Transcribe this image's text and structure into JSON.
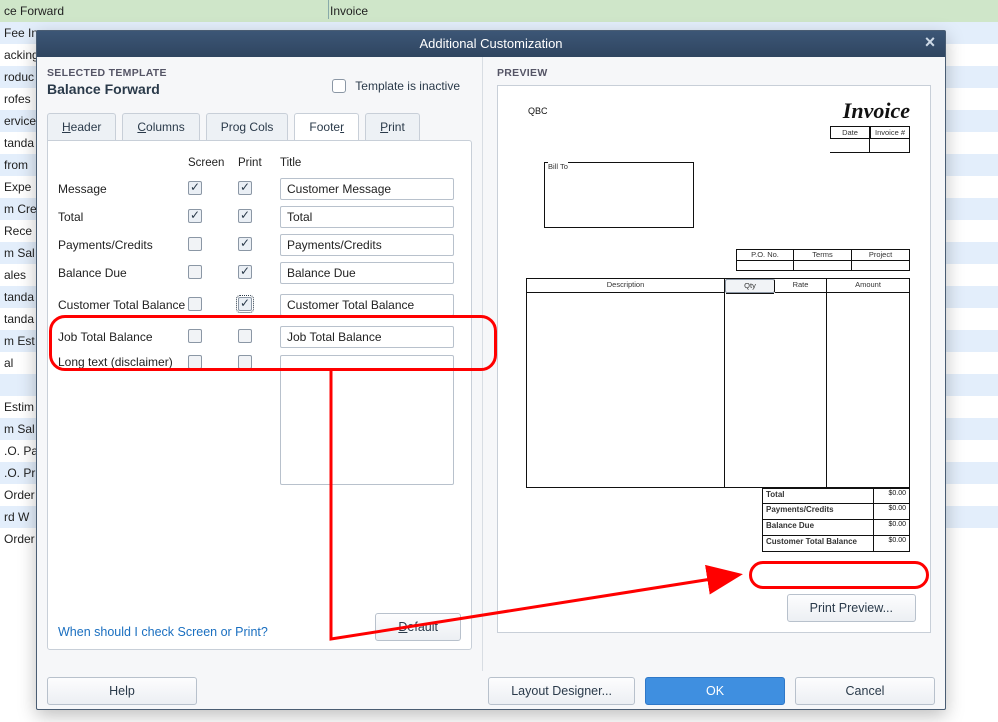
{
  "bg": {
    "head_left": "ce Forward",
    "head_right": "Invoice",
    "rows": [
      "Fee In",
      "acking",
      "roduc",
      "rofes",
      "ervice",
      "tanda",
      "from",
      "Expe",
      "m Cre",
      "Rece",
      "m Sal",
      "ales",
      "tanda",
      "tanda",
      "m Est",
      "al",
      "",
      "Estim",
      "m Sal",
      ".O. Pa",
      ".O. Pr",
      "Order",
      "rd W",
      "Order"
    ]
  },
  "dialog": {
    "title": "Additional Customization",
    "selected_template_label": "SELECTED TEMPLATE",
    "selected_template": "Balance Forward",
    "template_inactive_label": "Template is inactive",
    "tabs": {
      "header": "Header",
      "columns": "Columns",
      "prog": "Prog Cols",
      "footer": "Footer",
      "print": "Print"
    },
    "cols": {
      "screen": "Screen",
      "print": "Print",
      "title": "Title"
    },
    "rows": {
      "message": {
        "label": "Message",
        "title": "Customer Message"
      },
      "total": {
        "label": "Total",
        "title": "Total"
      },
      "payments": {
        "label": "Payments/Credits",
        "title": "Payments/Credits"
      },
      "baldue": {
        "label": "Balance Due",
        "title": "Balance Due"
      },
      "custtot": {
        "label": "Customer Total Balance",
        "title": "Customer Total Balance"
      },
      "jobtot": {
        "label": "Job Total Balance",
        "title": "Job Total Balance"
      },
      "disclaim": {
        "label": "Long text (disclaimer)"
      }
    },
    "help_link": "When should I check Screen or Print?",
    "default_btn": "Default",
    "help_btn": "Help",
    "layout_btn": "Layout Designer...",
    "ok_btn": "OK",
    "cancel_btn": "Cancel"
  },
  "preview": {
    "label": "PREVIEW",
    "print_preview": "Print Preview...",
    "qbc": "QBC",
    "title": "Invoice",
    "date": "Date",
    "invno": "Invoice #",
    "billto": "Bill To",
    "pono": "P.O. No.",
    "terms": "Terms",
    "project": "Project",
    "desc": "Description",
    "qty": "Qty",
    "rate": "Rate",
    "amount": "Amount",
    "total": "Total",
    "payments": "Payments/Credits",
    "baldue": "Balance Due",
    "custtot": "Customer Total Balance",
    "zero": "$0.00"
  }
}
